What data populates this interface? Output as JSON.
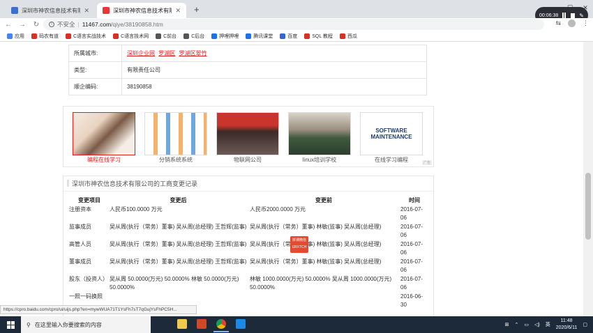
{
  "browser": {
    "tabs": [
      {
        "title": "深圳市神农信息技术有限公司_王...",
        "active": false
      },
      {
        "title": "深圳市神农信息技术有限公司_王...",
        "active": true
      }
    ],
    "url": {
      "insecure_label": "不安全",
      "host": "11467.com",
      "path": "/qiye/38190858.htm"
    },
    "bookmarks": [
      {
        "label": "应用",
        "color": "#4285f4"
      },
      {
        "label": "码农有道",
        "color": "#d93025"
      },
      {
        "label": "C语言实战技术",
        "color": "#d93025"
      },
      {
        "label": "C语言技术网",
        "color": "#d93025"
      },
      {
        "label": "C前台",
        "color": "#555555"
      },
      {
        "label": "C后台",
        "color": "#555555"
      },
      {
        "label": "押哩押哩",
        "color": "#1a73e8"
      },
      {
        "label": "腾讯课堂",
        "color": "#1a73e8"
      },
      {
        "label": "百度",
        "color": "#3367d6"
      },
      {
        "label": "SQL 教程",
        "color": "#d93025"
      },
      {
        "label": "西瓜",
        "color": "#d93025"
      }
    ]
  },
  "recorder": {
    "time": "00:06:38"
  },
  "info_rows": [
    {
      "key": "所属城市:",
      "links": [
        "深圳企业网",
        "罗湖区",
        "罗湖区翠竹"
      ]
    },
    {
      "key": "类型:",
      "value": "有限责任公司"
    },
    {
      "key": "顺企编码:",
      "value": "38190858"
    }
  ],
  "ads": [
    {
      "caption": "编程在线学习",
      "highlight": true
    },
    {
      "caption": "分销系统系统",
      "highlight": false
    },
    {
      "caption": "物联网公司",
      "highlight": false
    },
    {
      "caption": "linux培训学校",
      "highlight": false
    },
    {
      "caption": "在线学习编程",
      "highlight": false
    }
  ],
  "ad_badge": "广告",
  "change_section": {
    "title": "深圳市神农信息技术有限公司的工商变更记录",
    "headers": [
      "变更项目",
      "变更后",
      "变更前",
      "时间"
    ],
    "rows": [
      {
        "item": "注册资本",
        "after": "人民币100.0000 万元",
        "before": "人民币2000.0000 万元",
        "date": "2016-07-06"
      },
      {
        "item": "监事成员",
        "after": "吴从周(执行（常务）董事) 吴从周(总经理) 王哲辉(监事)",
        "before": "吴从周(执行（常务）董事) 林敏(监事) 吴从周(总经理)",
        "date": "2016-07-06"
      },
      {
        "item": "高管人员",
        "after": "吴从周(执行（常务）董事) 吴从周(总经理) 王哲辉(监事)",
        "before": "吴从周(执行（常务）董事) 林敏(监事) 吴从周(总经理)",
        "date": "2016-07-06"
      },
      {
        "item": "董事成员",
        "after": "吴从周(执行（常务）董事) 吴从周(总经理) 王哲辉(监事)",
        "before": "吴从周(执行（常务）董事) 林敏(监事) 吴从周(总经理)",
        "date": "2016-07-06"
      },
      {
        "item": "股东（投资人）",
        "after": "吴从周 50.0000(万元) 50.0000% 林敏 50.0000(万元) 50.0000%",
        "before": "林敏 1000.0000(万元) 50.0000% 吴从周 1000.0000(万元) 50.0000%",
        "date": "2016-07-06"
      },
      {
        "item": "一照一码换照",
        "after": "",
        "before": "",
        "date": "2016-06-30"
      }
    ]
  },
  "stamp": {
    "line1": "拼课微信",
    "line2": "ERXTCH"
  },
  "status_url": "https://cpro.baidu.com/cpro/ui/uijs.php?en=mywWUA71T1YsFh7sT7qGujYsFhPC5H...",
  "taskbar": {
    "search_placeholder": "在这里输入你要搜索的内容",
    "time": "11:48",
    "date": "2020/6/11"
  }
}
